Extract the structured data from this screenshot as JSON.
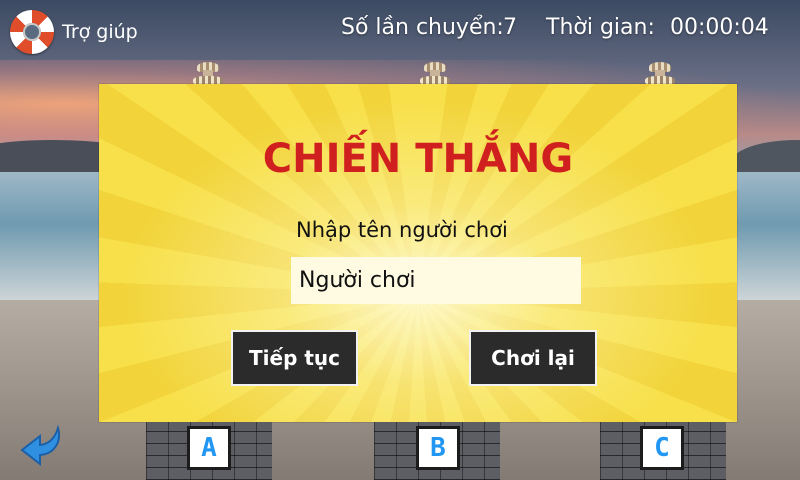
{
  "header": {
    "help_label": "Trợ giúp",
    "moves_label": "Số lần chuyển:",
    "moves_value": "7",
    "time_label": "Thời gian:",
    "time_value": "00:00:04"
  },
  "dialog": {
    "title": "CHIẾN THẮNG",
    "prompt": "Nhập tên người chơi",
    "name_value": "Người chơi",
    "continue_label": "Tiếp tục",
    "replay_label": "Chơi lại"
  },
  "pegs": [
    {
      "label": "A"
    },
    {
      "label": "B"
    },
    {
      "label": "C"
    }
  ],
  "colors": {
    "title": "#d01f1f",
    "dialog_bg": "#f7e04a",
    "button_bg": "#2b2b2b",
    "peg_letter": "#2196f3"
  },
  "icons": {
    "help": "lifebuoy-icon",
    "back": "back-arrow-icon"
  }
}
